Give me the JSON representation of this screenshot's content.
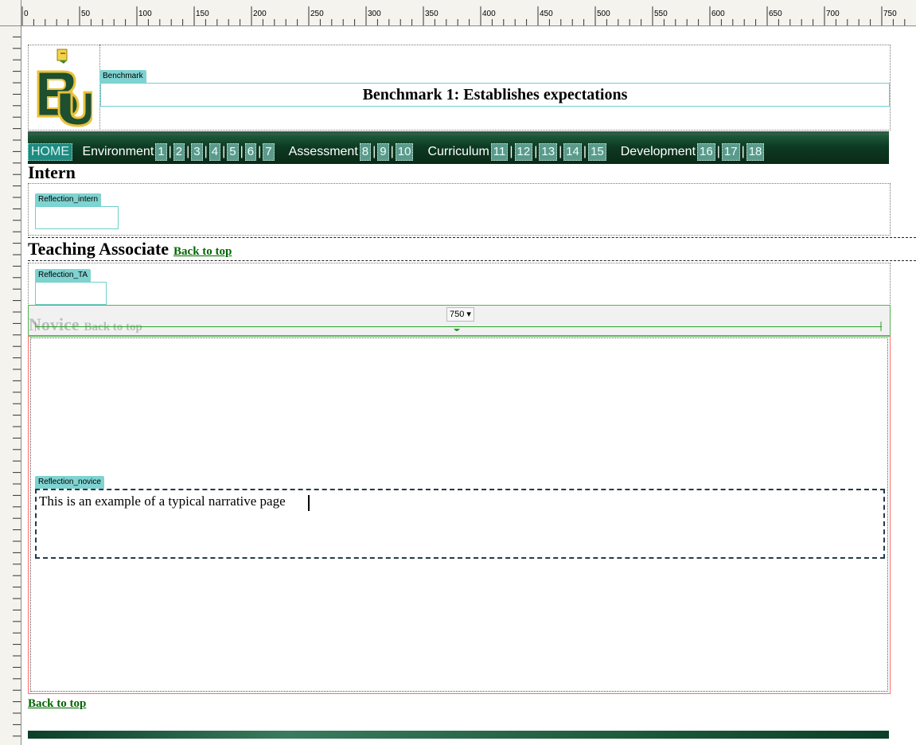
{
  "ruler": {
    "labels": [
      "0",
      "50",
      "100",
      "150",
      "200",
      "250",
      "300",
      "350",
      "400",
      "450",
      "500",
      "550",
      "600",
      "650",
      "700",
      "750"
    ]
  },
  "header": {
    "region_label": "Benchmark",
    "title": "Benchmark 1: Establishes expectations"
  },
  "nav": {
    "home": "HOME",
    "groups": [
      {
        "label": "Environment",
        "items": [
          "1",
          "2",
          "3",
          "4",
          "5",
          "6",
          "7"
        ]
      },
      {
        "label": "Assessment",
        "items": [
          "8",
          "9",
          "10"
        ]
      },
      {
        "label": "Curriculum",
        "items": [
          "11",
          "12",
          "13",
          "14",
          "15"
        ]
      },
      {
        "label": "Development",
        "items": [
          "16",
          "17",
          "18"
        ]
      }
    ]
  },
  "sections": {
    "intern": {
      "heading": "Intern",
      "region_label": "Reflection_intern"
    },
    "ta": {
      "heading": "Teaching Associate",
      "back": "Back to top",
      "region_label": "Reflection_TA"
    },
    "novice": {
      "heading": "Novice",
      "back": "Back to top",
      "region_label": "Reflection_novice",
      "body": "This is an example of a typical narrative page"
    }
  },
  "table_width": {
    "value": "750",
    "dropdown_icon": "chevron-down-icon"
  },
  "footer": {
    "back": "Back to top"
  },
  "colors": {
    "nav_bg": "#0d3a22",
    "editable_tab": "#7fd3d0",
    "link": "#006600"
  }
}
